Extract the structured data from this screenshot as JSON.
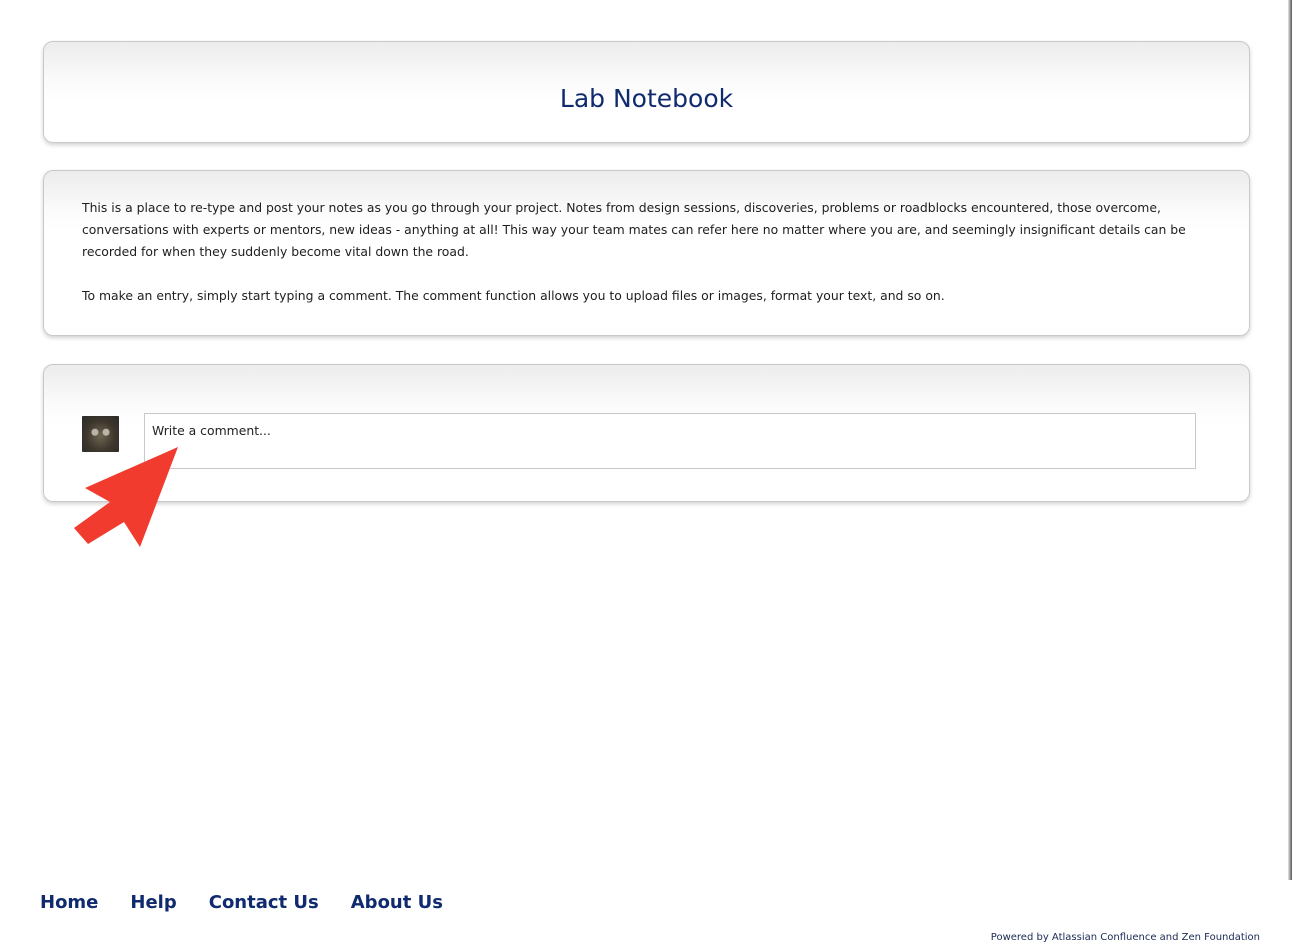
{
  "header": {
    "title": "Lab Notebook"
  },
  "description": {
    "paragraph_1": "This is a place to re-type and post your notes as you go through your project. Notes from design sessions, discoveries, problems or roadblocks encountered, those overcome, conversations with experts or mentors, new ideas - anything at all! This way your team mates can refer here no matter where you are, and seemingly insignificant details can be recorded for when they suddenly become vital down the road.",
    "paragraph_2": "To make an entry, simply start typing a comment. The comment function allows you to upload files or images, format your text, and so on."
  },
  "comment": {
    "placeholder": "Write a comment..."
  },
  "annotation": {
    "arrow_color": "#f23b2f",
    "icon": "arrow-icon"
  },
  "footer": {
    "links": [
      "Home",
      "Help",
      "Contact Us",
      "About Us"
    ],
    "powered_by": "Powered by Atlassian Confluence and Zen Foundation"
  },
  "colors": {
    "title": "#0f2a6e",
    "link": "#0f2a6e",
    "panel_border": "#c9c9c9"
  }
}
